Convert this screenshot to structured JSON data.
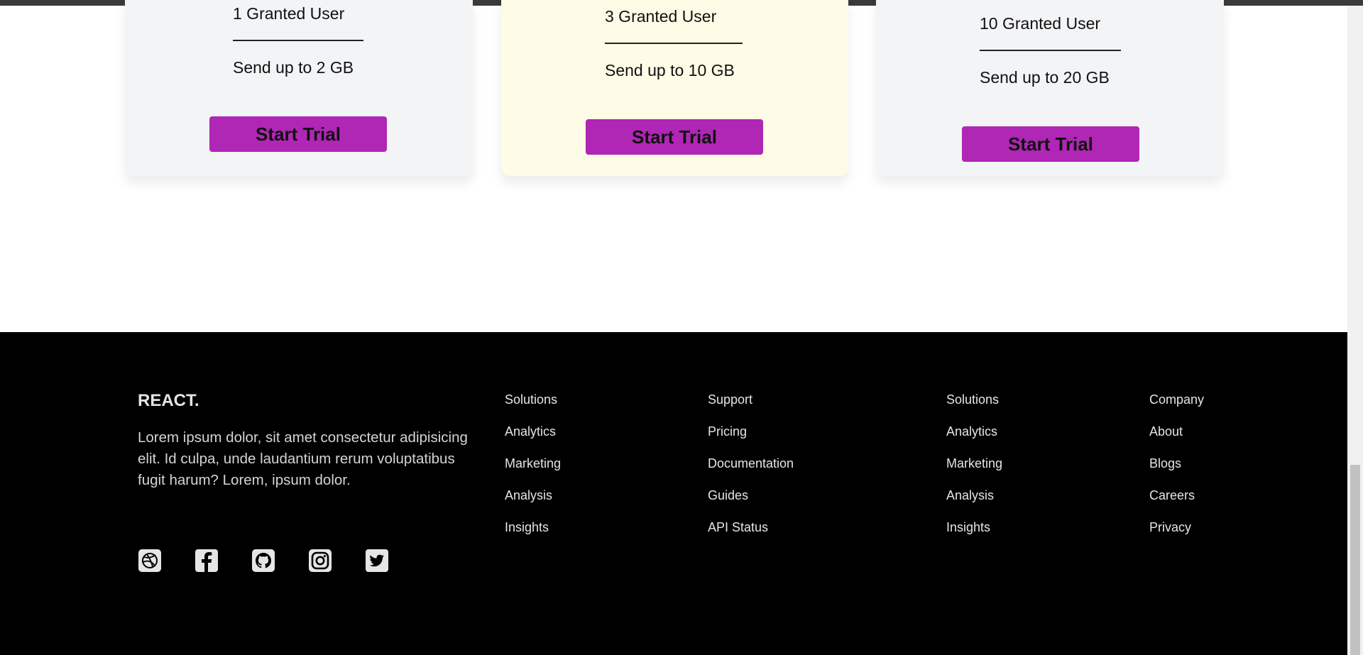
{
  "pricing": {
    "cards": [
      {
        "users": "1 Granted User",
        "storage": "Send up to 2 GB",
        "button": "Start Trial"
      },
      {
        "users": "3 Granted User",
        "storage": "Send up to 10 GB",
        "button": "Start Trial"
      },
      {
        "users": "10 Granted User",
        "storage": "Send up to 20 GB",
        "button": "Start Trial"
      }
    ]
  },
  "footer": {
    "brand": "REACT.",
    "blurb": "Lorem ipsum dolor, sit amet consectetur adipisicing elit. Id culpa, unde laudantium rerum voluptatibus fugit harum? Lorem, ipsum dolor.",
    "socials": [
      "dribbble-icon",
      "facebook-icon",
      "github-icon",
      "instagram-icon",
      "twitter-icon"
    ],
    "columns": [
      {
        "heading": "Solutions",
        "links": [
          "Analytics",
          "Marketing",
          "Analysis",
          "Insights"
        ]
      },
      {
        "heading": "Support",
        "links": [
          "Pricing",
          "Documentation",
          "Guides",
          "API Status"
        ]
      },
      {
        "heading": "Solutions",
        "links": [
          "Analytics",
          "Marketing",
          "Analysis",
          "Insights"
        ]
      },
      {
        "heading": "Company",
        "links": [
          "About",
          "Blogs",
          "Careers",
          "Privacy"
        ]
      }
    ]
  },
  "colors": {
    "accent": "#b026b5",
    "highlight_card": "#fefbe6",
    "card": "#f3f4f6",
    "footer_bg": "#000000"
  }
}
